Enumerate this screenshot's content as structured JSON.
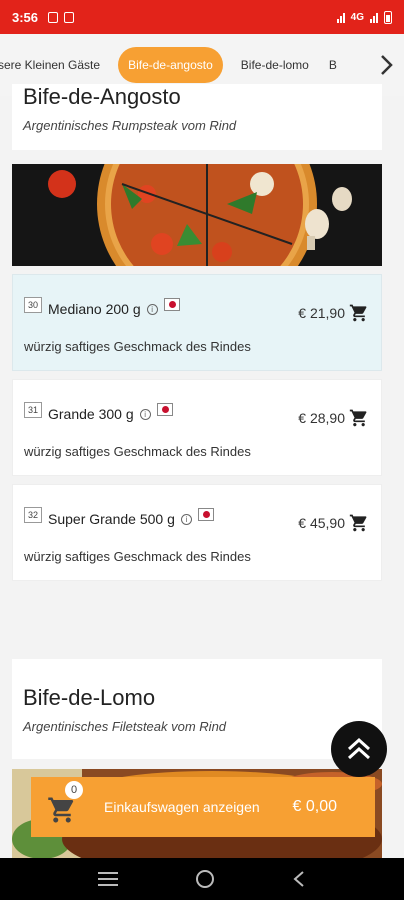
{
  "status": {
    "time": "3:56",
    "network": "4G"
  },
  "tabs": [
    {
      "label": "sere Kleinen Gäste"
    },
    {
      "label": "Bife-de-angosto"
    },
    {
      "label": "Bife-de-lomo"
    },
    {
      "label": "B"
    }
  ],
  "section1": {
    "title": "Bife-de-Angosto",
    "subtitle": "Argentinisches Rumpsteak vom Rind",
    "items": [
      {
        "num": "30",
        "name": "Mediano 200 g",
        "price": "€ 21,90",
        "desc": "würzig saftiges Geschmack des Rindes"
      },
      {
        "num": "31",
        "name": "Grande 300 g",
        "price": "€ 28,90",
        "desc": "würzig saftiges Geschmack des Rindes"
      },
      {
        "num": "32",
        "name": "Super Grande 500 g",
        "price": "€ 45,90",
        "desc": "würzig saftiges Geschmack des Rindes"
      }
    ]
  },
  "section2": {
    "title": "Bife-de-Lomo",
    "subtitle": "Argentinisches Filetsteak vom Rind"
  },
  "cart": {
    "count": "0",
    "label": "Einkaufswagen anzeigen",
    "total": "€ 0,00"
  },
  "colors": {
    "accent": "#f7a033",
    "status": "#e2231a",
    "selected_bg": "#e7f4f7"
  },
  "icons": [
    "info-icon",
    "flag-icon",
    "cart-icon",
    "chevron-right-icon",
    "double-chevron-up-icon",
    "menu-icon",
    "home-icon",
    "back-icon"
  ]
}
